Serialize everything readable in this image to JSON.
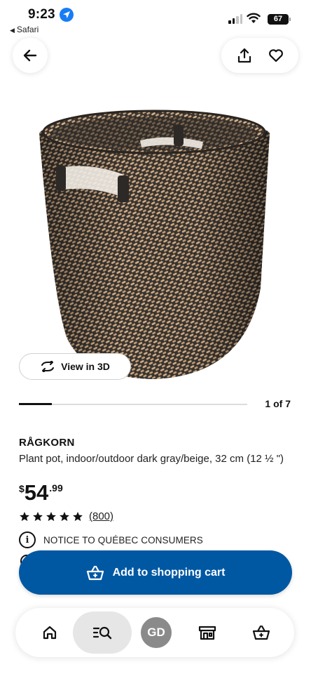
{
  "status_bar": {
    "time": "9:23",
    "back_app": "Safari",
    "battery": "67"
  },
  "product": {
    "image_alt": "Woven round basket plant pot, dark gray and beige",
    "view_3d_label": "View in 3D",
    "gallery_counter": "1 of 7",
    "gallery_progress": 0.143,
    "name": "RÅGKORN",
    "description": "Plant pot, indoor/outdoor dark gray/beige, 32 cm (12 ½ \")",
    "price": {
      "currency": "$",
      "dollars": "54",
      "cents": ".99"
    },
    "rating": {
      "stars": 5,
      "reviews": "(800)"
    },
    "notice": "NOTICE TO QUÉBEC CONSUMERS"
  },
  "cart_button": {
    "label": "Add to shopping cart"
  },
  "bottom_nav": {
    "profile_initials": "GD"
  },
  "colors": {
    "brand_blue": "#0058a3",
    "location_blue": "#1a7cf5",
    "avatar_gray": "#8a8a8a"
  },
  "icons": [
    "arrow-left-icon",
    "share-icon",
    "heart-icon",
    "rotate-3d-icon",
    "star-icon",
    "info-icon",
    "basket-icon",
    "home-icon",
    "search-list-icon",
    "store-icon"
  ]
}
